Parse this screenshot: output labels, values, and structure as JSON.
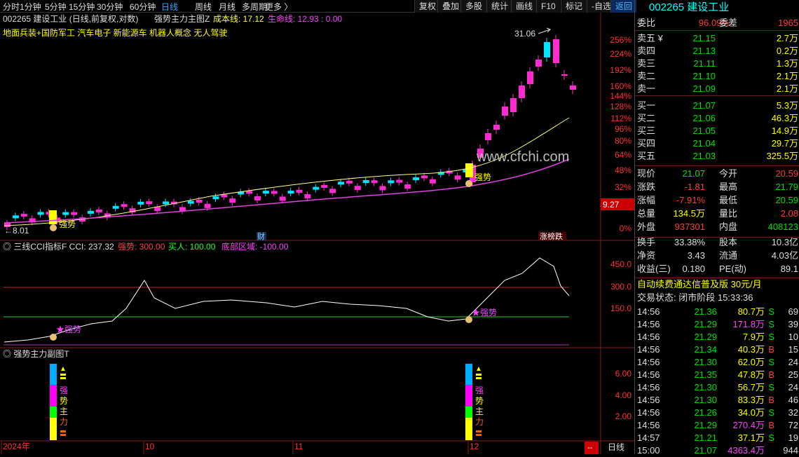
{
  "toolbar": {
    "periods": [
      "分时",
      "1分钟",
      "5分钟",
      "15分钟",
      "30分钟",
      "60分钟",
      "日线",
      "周线",
      "月线",
      "多周期",
      "更多 〉"
    ],
    "active": "日线",
    "buttons": [
      "复权",
      "叠加",
      "多股",
      "统计",
      "画线",
      "F10",
      "标记",
      "-自选",
      "返回"
    ]
  },
  "main": {
    "code": "002265",
    "title": "建设工业 (日线,前复权,对数)",
    "indicator": "强势主力主图Z",
    "cost_label": "成本线: 17.12",
    "life_label": "生命线: 12.93 : 0.00",
    "concepts": "地面兵装+国防军工  汽车电子  新能源车  机器人概念  无人驾驶",
    "high_label": "31.06",
    "low_label": "8.01",
    "watermark": "www.cfchi.com",
    "price_tag": "9.27",
    "signal_1": "强势",
    "signal_2": "强势",
    "cai_label": "财",
    "zhangbang_label": "涨榜跌",
    "y_axis": [
      "256%",
      "224%",
      "192%",
      "160%",
      "144%",
      "128%",
      "112%",
      "96%",
      "80%",
      "64%",
      "48%",
      "32%",
      "16%",
      "0%"
    ]
  },
  "cci": {
    "title": "三线CCI指标F  CCI: 237.32",
    "strong": "强势: 300.00",
    "buy": "买人: 100.00",
    "bottom": "底部区域: -100.00",
    "y_axis": [
      "450.0",
      "300.0",
      "150.0"
    ],
    "sig1": "★强势",
    "sig2": "★强势"
  },
  "sub": {
    "title": "强势主力副图T",
    "y_axis": [
      "6.00",
      "4.00",
      "2.00"
    ],
    "col_chars": [
      "强",
      "势",
      "主",
      "力"
    ]
  },
  "xaxis": {
    "labels": [
      "2024年",
      "10",
      "11",
      "12"
    ],
    "period": "日线",
    "dash": "--"
  },
  "quote": {
    "code": "002265",
    "name": "建设工业",
    "weibi_label": "委比",
    "weibi": "96.09%",
    "weicha_label": "委差",
    "weicha": "1965",
    "asks": [
      {
        "label": "卖五 ¥",
        "price": "21.15",
        "vol": "2.7万"
      },
      {
        "label": "卖四",
        "price": "21.13",
        "vol": "0.2万"
      },
      {
        "label": "卖三",
        "price": "21.11",
        "vol": "1.3万"
      },
      {
        "label": "卖二",
        "price": "21.10",
        "vol": "2.1万"
      },
      {
        "label": "卖一",
        "price": "21.09",
        "vol": "2.1万"
      }
    ],
    "bids": [
      {
        "label": "买一",
        "price": "21.07",
        "vol": "5.3万"
      },
      {
        "label": "买二",
        "price": "21.06",
        "vol": "46.3万"
      },
      {
        "label": "买三",
        "price": "21.05",
        "vol": "14.9万"
      },
      {
        "label": "买四",
        "price": "21.04",
        "vol": "29.7万"
      },
      {
        "label": "买五",
        "price": "21.03",
        "vol": "325.5万"
      }
    ],
    "stats": [
      {
        "l1": "现价",
        "v1": "21.07",
        "l2": "今开",
        "v2": "20.59"
      },
      {
        "l1": "涨跌",
        "v1": "-1.81",
        "l2": "最高",
        "v2": "21.79"
      },
      {
        "l1": "涨幅",
        "v1": "-7.91%",
        "l2": "最低",
        "v2": "20.59"
      },
      {
        "l1": "总量",
        "v1": "134.5万",
        "l2": "量比",
        "v2": "2.08"
      },
      {
        "l1": "外盘",
        "v1": "937301",
        "l2": "内盘",
        "v2": "408123"
      }
    ],
    "stats2": [
      {
        "l1": "换手",
        "v1": "33.38%",
        "l2": "股本",
        "v2": "10.3亿"
      },
      {
        "l1": "净资",
        "v1": "3.43",
        "l2": "流通",
        "v2": "4.03亿"
      },
      {
        "l1": "收益(三)",
        "v1": "0.180",
        "l2": "PE(动)",
        "v2": "89.1"
      }
    ],
    "promo": "自动续费通达信普及版  30元/月",
    "status": "交易状态: 闭市阶段 15:33:36",
    "ticks": [
      {
        "t": "14:56",
        "p": "21.36",
        "v": "80.7万",
        "s": "S",
        "n": "69"
      },
      {
        "t": "14:56",
        "p": "21.29",
        "v": "171.8万",
        "s": "S",
        "n": "39"
      },
      {
        "t": "14:56",
        "p": "21.29",
        "v": "7.9万",
        "s": "S",
        "n": "10"
      },
      {
        "t": "14:56",
        "p": "21.34",
        "v": "40.3万",
        "s": "B",
        "n": "15"
      },
      {
        "t": "14:56",
        "p": "21.30",
        "v": "62.0万",
        "s": "S",
        "n": "24"
      },
      {
        "t": "14:56",
        "p": "21.35",
        "v": "47.8万",
        "s": "B",
        "n": "25"
      },
      {
        "t": "14:56",
        "p": "21.30",
        "v": "56.7万",
        "s": "S",
        "n": "24"
      },
      {
        "t": "14:56",
        "p": "21.30",
        "v": "83.3万",
        "s": "B",
        "n": "46"
      },
      {
        "t": "14:56",
        "p": "21.26",
        "v": "34.0万",
        "s": "S",
        "n": "32"
      },
      {
        "t": "14:56",
        "p": "21.29",
        "v": "270.4万",
        "s": "B",
        "n": "72"
      },
      {
        "t": "14:57",
        "p": "21.21",
        "v": "37.1万",
        "s": "S",
        "n": "19"
      },
      {
        "t": "15:00",
        "p": "21.07",
        "v": "4363.4万",
        "s": "",
        "n": "944"
      }
    ]
  },
  "colors": {
    "up": "#ff2bd0",
    "down": "#00e5ff",
    "cost": "#ffff80",
    "life": "#e040e0",
    "cci": "#ffffff",
    "strong": "#cc2222",
    "buy": "#22cc22"
  }
}
